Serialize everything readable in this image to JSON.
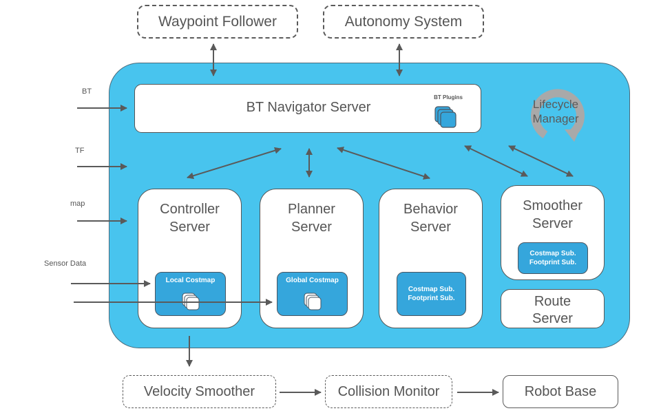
{
  "external_top": {
    "waypoint_follower": "Waypoint Follower",
    "autonomy_system": "Autonomy System"
  },
  "inputs": {
    "bt": "BT",
    "tf": "TF",
    "map": "map",
    "sensor_data": "Sensor Data"
  },
  "bt_navigator": {
    "title": "BT Navigator Server",
    "plugins_label": "BT Plugins"
  },
  "lifecycle_manager": {
    "line1": "Lifecycle",
    "line2": "Manager"
  },
  "servers": {
    "controller": {
      "line1": "Controller",
      "line2": "Server",
      "inner": "Local Costmap"
    },
    "planner": {
      "line1": "Planner",
      "line2": "Server",
      "inner": "Global Costmap"
    },
    "behavior": {
      "line1": "Behavior",
      "line2": "Server",
      "inner_line1": "Costmap Sub.",
      "inner_line2": "Footprint Sub."
    },
    "smoother": {
      "line1": "Smoother",
      "line2": "Server",
      "inner_line1": "Costmap Sub.",
      "inner_line2": "Footprint Sub."
    },
    "route": {
      "line1": "Route",
      "line2": "Server"
    }
  },
  "external_bottom": {
    "velocity_smoother": "Velocity Smoother",
    "collision_monitor": "Collision Monitor",
    "robot_base": "Robot Base"
  },
  "colors": {
    "panel_blue": "#48c4ee",
    "inner_blue": "#35a6dc",
    "arrow_gray": "#5a5a5a",
    "lifecycle_gray": "#a9a9a9"
  }
}
